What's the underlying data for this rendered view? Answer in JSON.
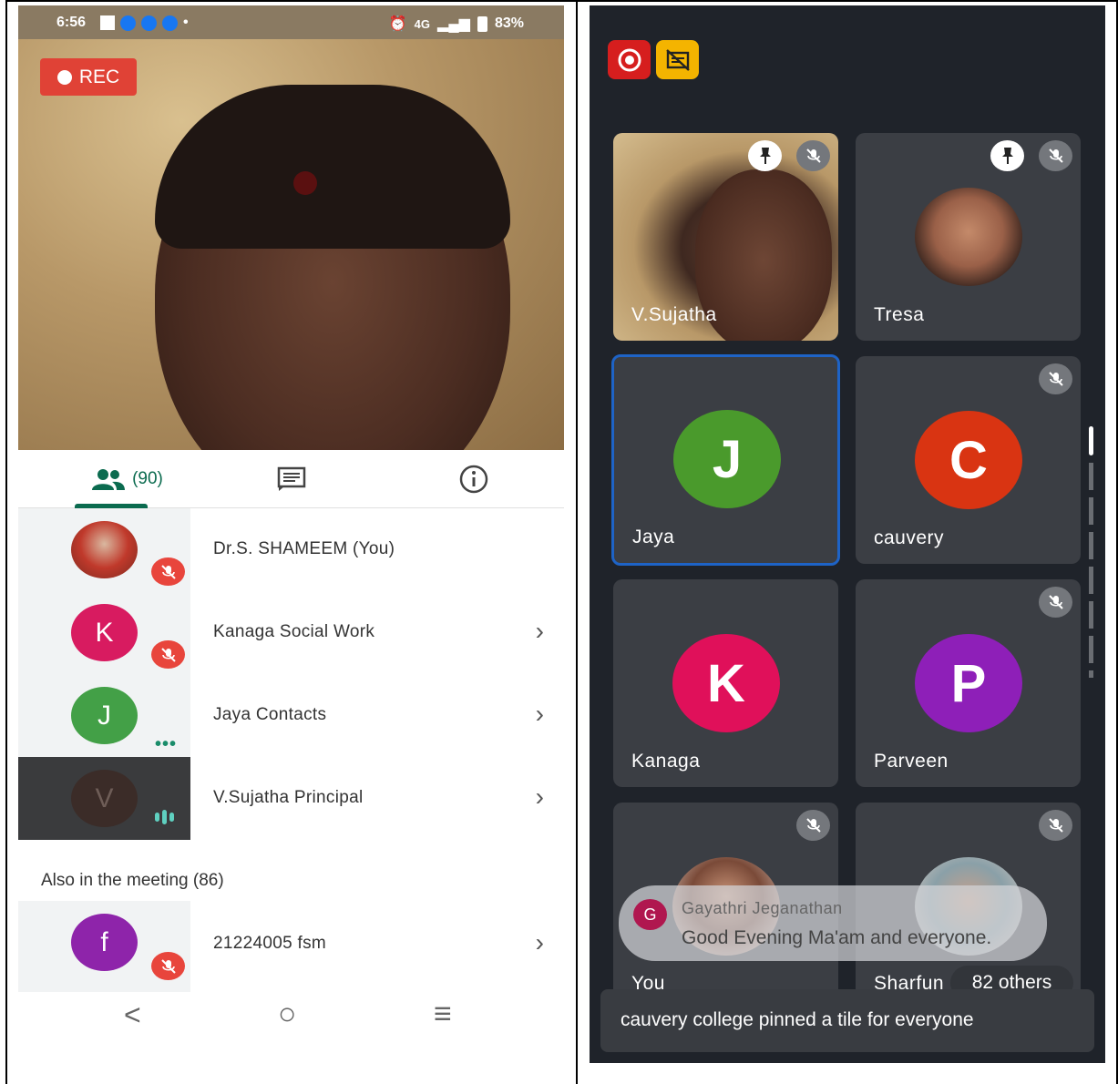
{
  "left_phone": {
    "status_bar": {
      "time": "6:56",
      "network": "4G",
      "battery": "83%"
    },
    "rec_label": "REC",
    "tabs": {
      "people_count": "(90)"
    },
    "participants": [
      {
        "name": "Dr.S. SHAMEEM (You)",
        "initial": "",
        "color": "#c0392b",
        "muted": true
      },
      {
        "name": "Kanaga Social Work",
        "initial": "K",
        "color": "#d81b60",
        "muted": true
      },
      {
        "name": "Jaya Contacts",
        "initial": "J",
        "color": "#43a047",
        "muted": false
      },
      {
        "name": "V.Sujatha Principal",
        "initial": "V",
        "color": "#3b2c28",
        "muted": false
      }
    ],
    "also_in_meeting": "Also in the meeting (86)",
    "also_participants": [
      {
        "name": "21224005 fsm",
        "initial": "f",
        "color": "#8e24aa",
        "muted": true
      }
    ],
    "nav": {
      "back": "<",
      "home": "○",
      "menu": "≡"
    }
  },
  "right_phone": {
    "tiles": [
      {
        "name": "V.Sujatha",
        "initial": "",
        "color": ""
      },
      {
        "name": "Tresa",
        "initial": "",
        "color": ""
      },
      {
        "name": "Jaya",
        "initial": "J",
        "color": "#4a9a2c"
      },
      {
        "name": "cauvery",
        "initial": "C",
        "color": "#d93412"
      },
      {
        "name": "Kanaga",
        "initial": "K",
        "color": "#e0105a"
      },
      {
        "name": "Parveen",
        "initial": "P",
        "color": "#8e1fb8"
      },
      {
        "name": "You",
        "initial": "",
        "color": ""
      },
      {
        "name": "Sharfun",
        "initial": "",
        "color": ""
      }
    ],
    "chat_toast": {
      "initial": "G",
      "sender": "Gayathri Jeganathan",
      "message": "Good Evening Ma'am and everyone."
    },
    "others_pill": "82 others",
    "pin_banner": "cauvery college pinned a tile for everyone"
  },
  "colors": {
    "accent_green": "#0b6b4f",
    "rec_red": "#e04236",
    "meet_dark": "#1f232a",
    "tile_gray": "#3b3e44",
    "active_blue": "#1e63c6"
  }
}
